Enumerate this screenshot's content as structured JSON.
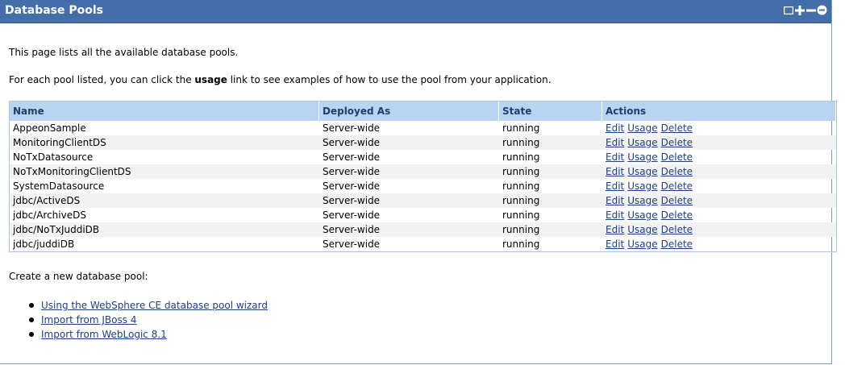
{
  "portlet": {
    "title": "Database Pools",
    "controls": [
      "window-restore-icon",
      "maximize-icon",
      "minimize-icon",
      "close-icon"
    ]
  },
  "intro": {
    "line1": "This page lists all the available database pools.",
    "line2_prefix": "For each pool listed, you can click the ",
    "line2_bold": "usage",
    "line2_suffix": " link to see examples of how to use the pool from your application."
  },
  "table": {
    "headers": [
      "Name",
      "Deployed As",
      "State",
      "Actions"
    ],
    "action_labels": [
      "Edit",
      "Usage",
      "Delete"
    ],
    "rows": [
      {
        "name": "AppeonSample",
        "deployed": "Server-wide",
        "state": "running"
      },
      {
        "name": "MonitoringClientDS",
        "deployed": "Server-wide",
        "state": "running"
      },
      {
        "name": "NoTxDatasource",
        "deployed": "Server-wide",
        "state": "running"
      },
      {
        "name": "NoTxMonitoringClientDS",
        "deployed": "Server-wide",
        "state": "running"
      },
      {
        "name": "SystemDatasource",
        "deployed": "Server-wide",
        "state": "running"
      },
      {
        "name": "jdbc/ActiveDS",
        "deployed": "Server-wide",
        "state": "running"
      },
      {
        "name": "jdbc/ArchiveDS",
        "deployed": "Server-wide",
        "state": "running"
      },
      {
        "name": "jdbc/NoTxJuddiDB",
        "deployed": "Server-wide",
        "state": "running"
      },
      {
        "name": "jdbc/juddiDB",
        "deployed": "Server-wide",
        "state": "running"
      }
    ]
  },
  "create": {
    "label": "Create a new database pool:",
    "links": [
      "Using the WebSphere CE database pool wizard",
      "Import from JBoss 4",
      "Import from WebLogic 8.1"
    ]
  }
}
